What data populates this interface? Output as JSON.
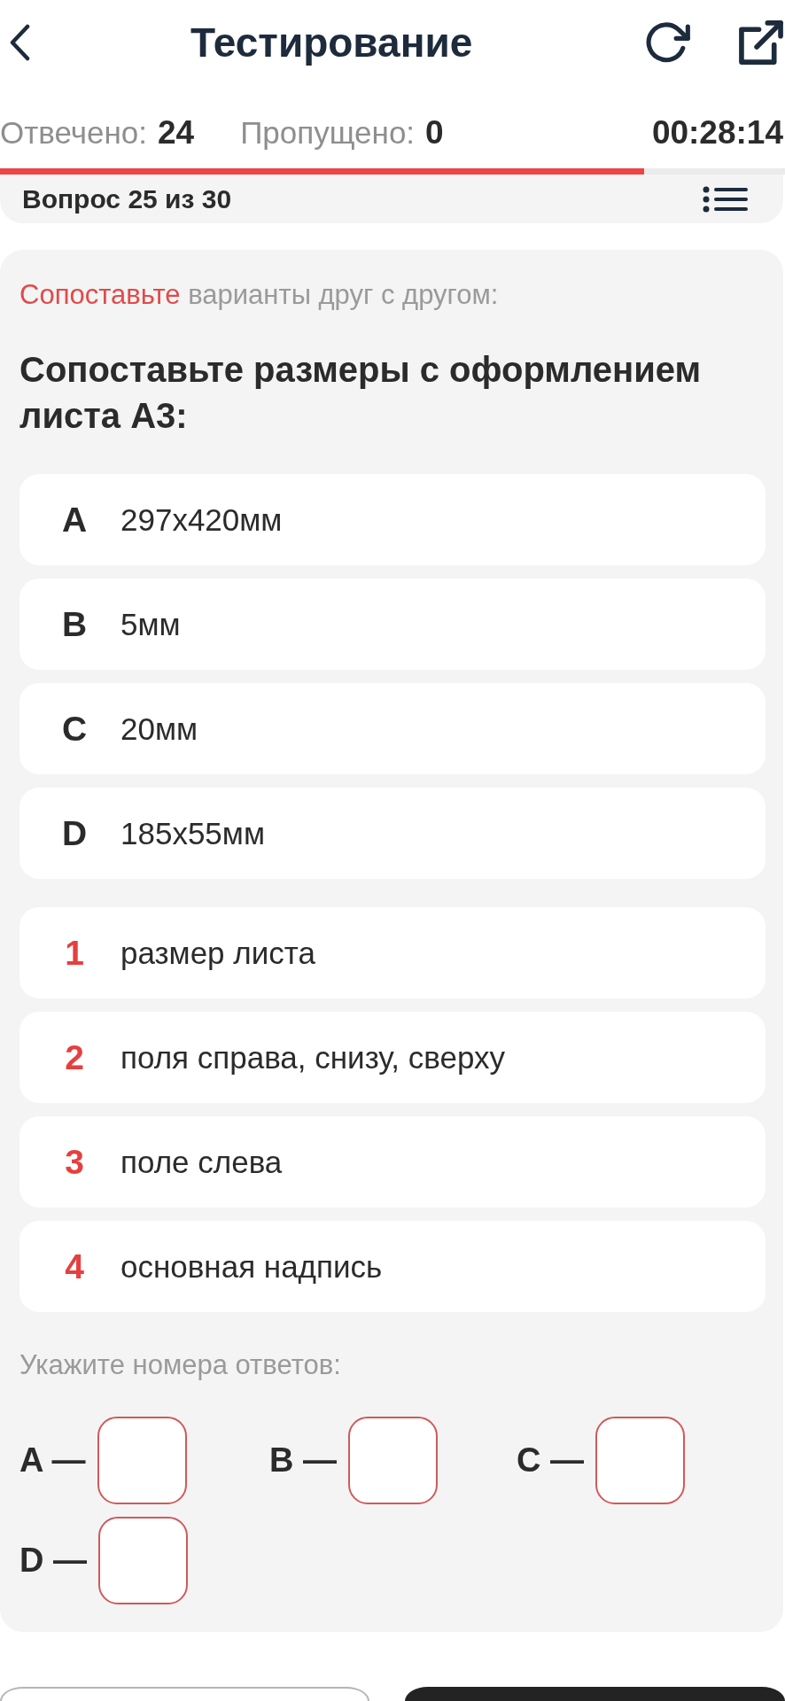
{
  "header": {
    "title": "Тестирование"
  },
  "stats": [
    {
      "label": "Отвечено:",
      "value": "24"
    },
    {
      "label": "Пропущено:",
      "value": "0"
    }
  ],
  "timer": "00:28:14",
  "progress": {
    "level": 0.82
  },
  "question_header": {
    "title": "Вопрос 25 из 30"
  },
  "question": {
    "instruction": "**Сопоставьте** варианты друг с другом:",
    "text": "Сопоставьте размеры с оформлением листа А3:",
    "options": [
      {
        "key": "A",
        "text": "297x420мм"
      },
      {
        "key": "B",
        "text": "5мм"
      },
      {
        "key": "C",
        "text": "20мм"
      },
      {
        "key": "D",
        "text": "185x55мм"
      }
    ],
    "matches": [
      {
        "key": "1",
        "text": "размер листа"
      },
      {
        "key": "2",
        "text": "поля справа, снизу, сверху"
      },
      {
        "key": "3",
        "text": "поле слева"
      },
      {
        "key": "4",
        "text": "основная надпись"
      }
    ],
    "answer_prompt": "Укажите номера ответов:",
    "answer_fields": [
      {
        "label": "A —"
      },
      {
        "label": "B —"
      },
      {
        "label": "C —"
      },
      {
        "label": "D —"
      }
    ]
  },
  "footer": {
    "buttons": [
      {
        "kind": "outline"
      },
      {
        "kind": "filled"
      }
    ]
  }
}
